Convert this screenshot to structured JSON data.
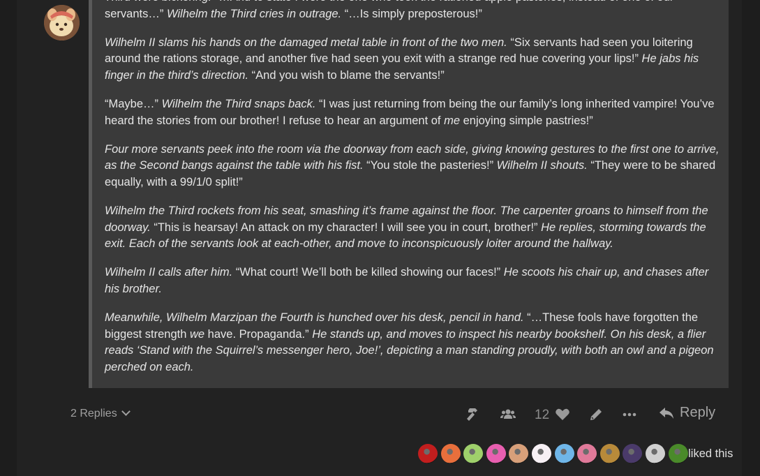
{
  "post": {
    "paragraphs": [
      [
        {
          "t": "Third were bickering.",
          "i": true
        },
        {
          "t": " “…And to state I were the one who took the rationed apple pasteries, instead of one of our servants…” ",
          "i": false
        },
        {
          "t": "Wilhelm the Third cries in outrage.",
          "i": true
        },
        {
          "t": " “…Is simply preposterous!”",
          "i": false
        }
      ],
      [
        {
          "t": "Wilhelm II slams his hands on the damaged metal table in front of the two men.",
          "i": true
        },
        {
          "t": " “Six servants had seen you loitering around the rations storage, and another five had seen you exit with a strange red hue covering your lips!” ",
          "i": false
        },
        {
          "t": "He jabs his finger in the third’s direction.",
          "i": true
        },
        {
          "t": " “And you wish to blame the servants!”",
          "i": false
        }
      ],
      [
        {
          "t": "“Maybe…” ",
          "i": false
        },
        {
          "t": "Wilhelm the Third snaps back.",
          "i": true
        },
        {
          "t": " “I was just returning from being the our family’s long inherited vampire! You’ve heard the stories from our brother! I refuse to hear an argument of ",
          "i": false
        },
        {
          "t": "me",
          "i": true
        },
        {
          "t": " enjoying simple pastries!”",
          "i": false
        }
      ],
      [
        {
          "t": "Four more servants peek into the room via the doorway from each side, giving knowing gestures to the first one to arrive, as the Second bangs against the table with his fist.",
          "i": true
        },
        {
          "t": " “You stole the pasteries!” ",
          "i": false
        },
        {
          "t": "Wilhelm II shouts.",
          "i": true
        },
        {
          "t": " “They were to be shared equally, with a 99/1/0 split!”",
          "i": false
        }
      ],
      [
        {
          "t": "Wilhelm the Third rockets from his seat, smashing it’s frame against the floor. The carpenter groans to himself from the doorway.",
          "i": true
        },
        {
          "t": " “This is hearsay! An attack on my character! I will see you in court, brother!” ",
          "i": false
        },
        {
          "t": "He replies, storming towards the exit. Each of the servants look at each-other, and move to inconspicuously loiter around the hallway.",
          "i": true
        }
      ],
      [
        {
          "t": "Wilhelm II calls after him.",
          "i": true
        },
        {
          "t": " “What court! We’ll both be killed showing our faces!” ",
          "i": false
        },
        {
          "t": "He scoots his chair up, and chases after his brother.",
          "i": true
        }
      ],
      [
        {
          "t": "Meanwhile, Wilhelm Marzipan the Fourth is hunched over his desk, pencil in hand.",
          "i": true
        },
        {
          "t": " “…These fools have forgotten the biggest strength ",
          "i": false
        },
        {
          "t": "we",
          "i": true
        },
        {
          "t": " have. Propaganda.” ",
          "i": false
        },
        {
          "t": "He stands up, and moves to inspect his nearby bookshelf. On his desk, a flier reads ‘Stand with the Squirrel’s messenger hero, Joe!’, depicting a man standing proudly, with both an owl and a pigeon perched on each.",
          "i": true
        }
      ]
    ]
  },
  "controls": {
    "replies_label": "2 Replies",
    "like_count": "12",
    "reply_label": "Reply",
    "icons": [
      "hammer-icon",
      "users-icon",
      "heart-icon",
      "pencil-icon",
      "ellipsis-icon",
      "reply-arrow-icon"
    ]
  },
  "likers": {
    "label": "liked this",
    "avatar_colors": [
      "#c21e1e",
      "#e86f3c",
      "#9fd06b",
      "#e85fb0",
      "#d8a07a",
      "#f7f0f4",
      "#6fb6e8",
      "#e07a9a",
      "#b88a3a",
      "#4a3a6a",
      "#d0d0d0",
      "#4a8a2a"
    ]
  },
  "colors": {
    "page_bg": "#1d1d1d",
    "post_bg": "#222222",
    "quote_bg": "#3a3a3a",
    "text": "#e6e6e6",
    "muted": "#a0a0a0"
  }
}
